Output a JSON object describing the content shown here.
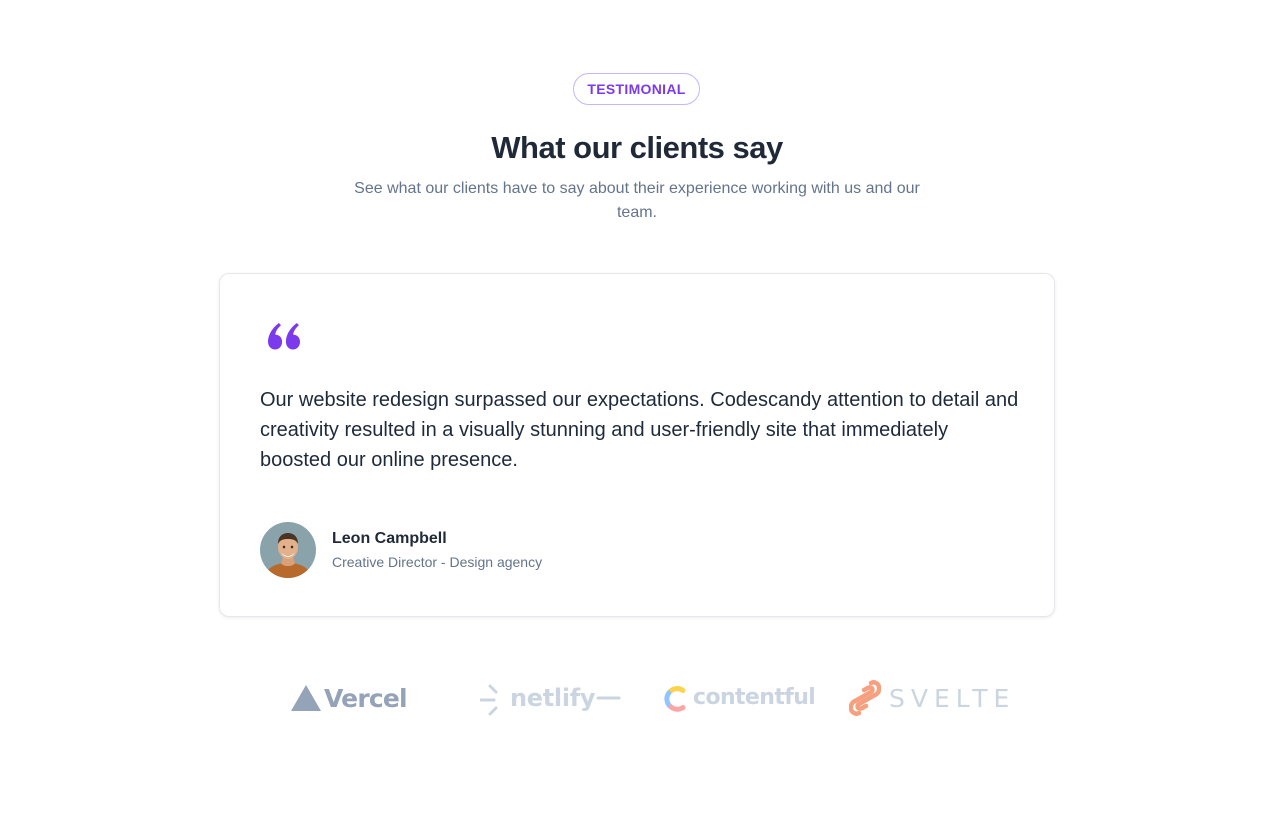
{
  "section": {
    "badge": "TESTIMONIAL",
    "title": "What our clients say",
    "subtitle": "See what our clients have to say about their experience working with us and our team."
  },
  "testimonial": {
    "quote_icon": "quote-icon",
    "quote": "Our website redesign surpassed our expectations. Codescandy attention to detail and creativity resulted in a visually stunning and user-friendly site that immediately boosted our online presence.",
    "author_name": "Leon Campbell",
    "author_role": "Creative Director - Design agency"
  },
  "logos": [
    {
      "name": "Vercel",
      "icon": "vercel-triangle-icon"
    },
    {
      "name": "netlify",
      "icon": "netlify-icon"
    },
    {
      "name": "contentful",
      "icon": "contentful-icon"
    },
    {
      "name": "SVELTE",
      "icon": "svelte-icon"
    }
  ],
  "colors": {
    "accent": "#7c3aed",
    "accent_border": "#c4b5fd",
    "heading": "#1f2937",
    "muted": "#64748b",
    "logo_gray": "#cbd5e1",
    "svelte_orange": "#f6a07f"
  }
}
